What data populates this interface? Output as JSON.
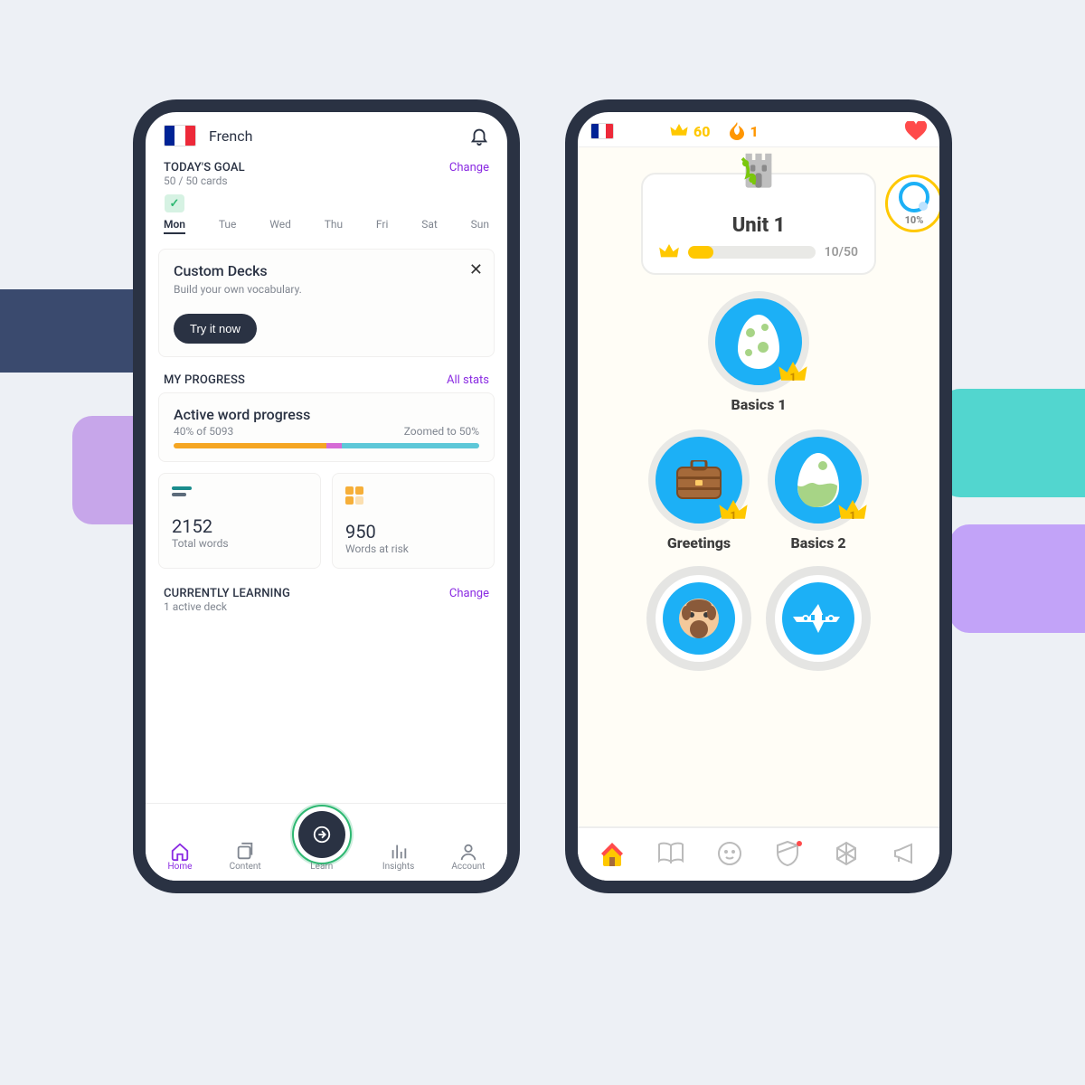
{
  "phoneA": {
    "header": {
      "language": "French"
    },
    "todaysGoal": {
      "title": "TODAY'S GOAL",
      "progress": "50 / 50 cards",
      "changeLabel": "Change",
      "days": [
        "Mon",
        "Tue",
        "Wed",
        "Thu",
        "Fri",
        "Sat",
        "Sun"
      ],
      "completedDayIndex": 0
    },
    "customDecks": {
      "title": "Custom Decks",
      "subtitle": "Build your own vocabulary.",
      "cta": "Try it now"
    },
    "myProgress": {
      "title": "MY PROGRESS",
      "allLink": "All stats"
    },
    "activeWord": {
      "title": "Active word progress",
      "pctLabel": "40% of 5093",
      "zoomLabel": "Zoomed to 50%"
    },
    "stats": {
      "totalWords": {
        "value": "2152",
        "label": "Total words"
      },
      "atRisk": {
        "value": "950",
        "label": "Words at risk"
      }
    },
    "currentlyLearning": {
      "title": "CURRENTLY LEARNING",
      "subtitle": "1 active deck",
      "changeLabel": "Change"
    },
    "nav": {
      "home": "Home",
      "content": "Content",
      "learn": "Learn",
      "insights": "Insights",
      "account": "Account"
    }
  },
  "phoneB": {
    "top": {
      "crowns": "60",
      "streak": "1",
      "badgePct": "10%"
    },
    "unit": {
      "title": "Unit 1",
      "progress": "10/50"
    },
    "skills": {
      "basics1": {
        "label": "Basics 1",
        "crown": "1"
      },
      "greetings": {
        "label": "Greetings",
        "crown": "1"
      },
      "basics2": {
        "label": "Basics 2",
        "crown": "1"
      }
    }
  }
}
